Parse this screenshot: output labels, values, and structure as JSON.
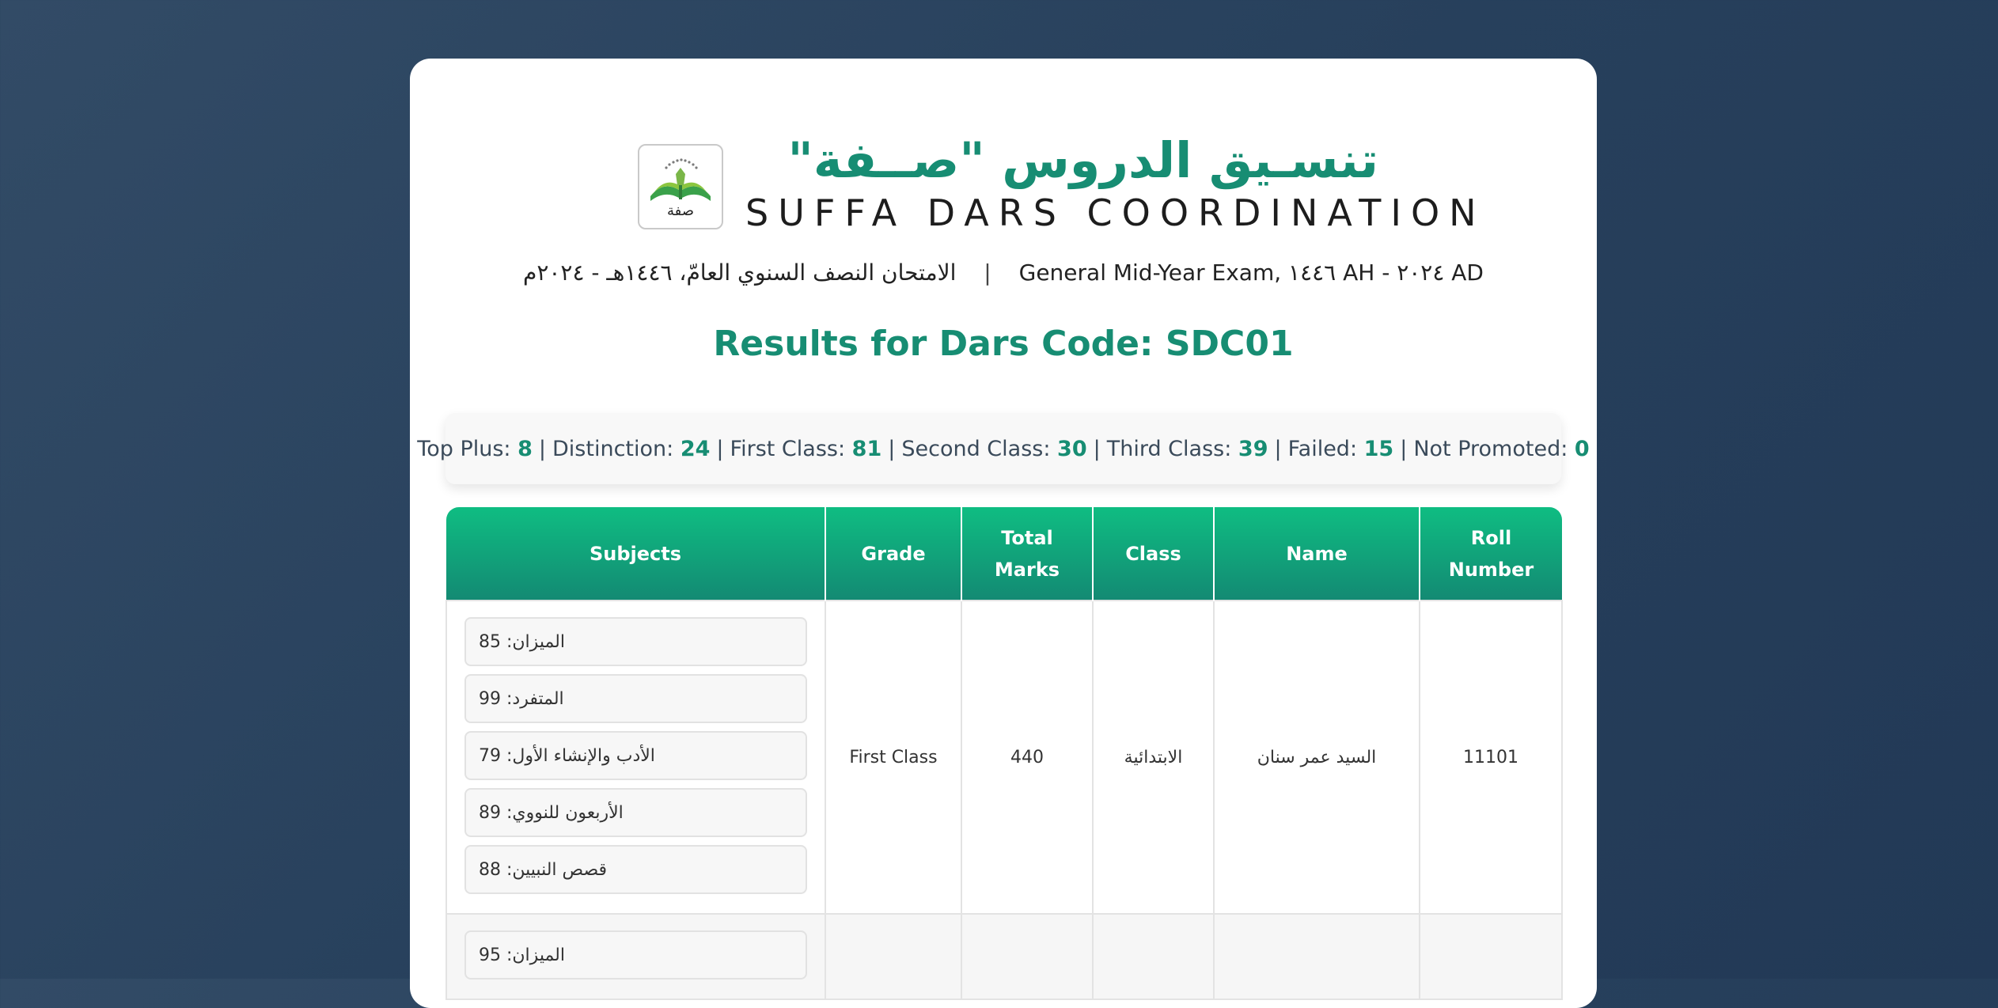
{
  "header": {
    "logo_label": "صفة",
    "title_ar": "تنسـيق الدروس \"صــفة\"",
    "title_en": "SUFFA DARS COORDINATION",
    "exam_en": "General Mid-Year Exam, ١٤٤٦ AH - ٢٠٢٤ AD",
    "exam_separator": "|",
    "exam_ar": "الامتحان النصف السنوي العامّ، ١٤٤٦هـ - ٢٠٢٤م",
    "results_title": "Results for Dars Code: SDC01"
  },
  "summary": {
    "top_plus_label": "Top Plus:",
    "top_plus": "8",
    "distinction_label": "Distinction:",
    "distinction": "24",
    "first_class_label": "First Class:",
    "first_class": "81",
    "second_class_label": "Second Class:",
    "second_class": "30",
    "third_class_label": "Third Class:",
    "third_class": "39",
    "failed_label": "Failed:",
    "failed": "15",
    "not_promoted_label": "Not Promoted:",
    "not_promoted": "0"
  },
  "table": {
    "headers": [
      "Subjects",
      "Grade",
      "Total Marks",
      "Class",
      "Name",
      "Roll Number"
    ],
    "rows": [
      {
        "subjects": [
          "الميزان: 85",
          "المتفرد: 99",
          "الأدب والإنشاء الأول: 79",
          "الأربعون للنووي: 89",
          "قصص النبيين: 88"
        ],
        "grade": "First Class",
        "total": "440",
        "class": "الابتدائية",
        "name": "السيد عمر سنان",
        "roll": "11101"
      },
      {
        "subjects": [
          "الميزان: 95"
        ],
        "grade": "",
        "total": "",
        "class": "",
        "name": "",
        "roll": ""
      }
    ]
  },
  "colors": {
    "accent": "#178d73",
    "header_gradient_top": "#0fbd82",
    "header_gradient_bottom": "#138a73",
    "background": "#2c4560"
  }
}
